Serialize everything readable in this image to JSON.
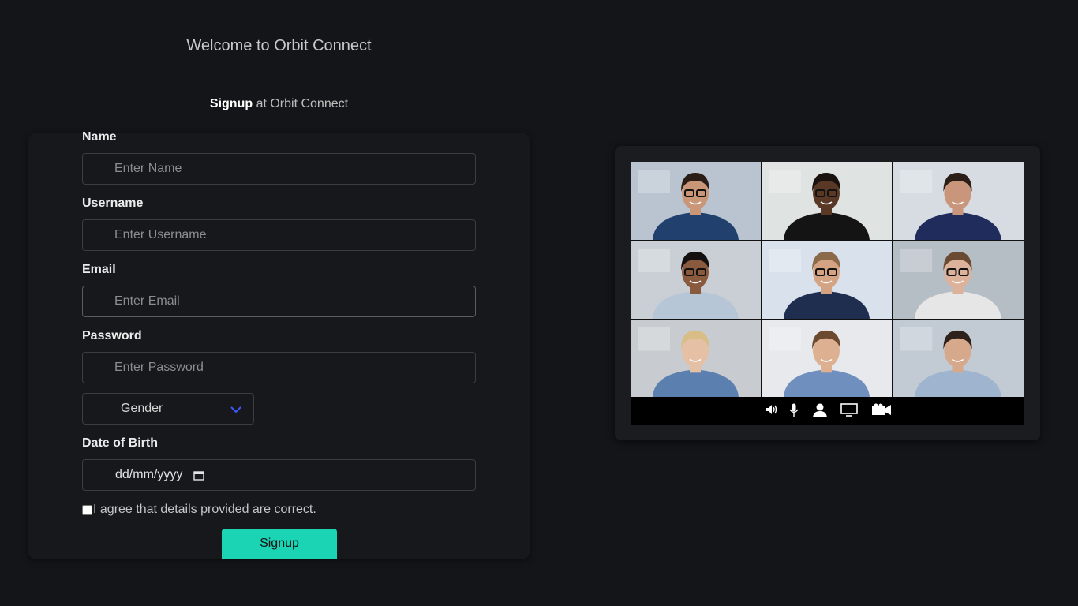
{
  "header": {
    "welcome": "Welcome to Orbit Connect",
    "signup_bold": "Signup",
    "signup_rest": " at Orbit Connect"
  },
  "form": {
    "name": {
      "label": "Name",
      "placeholder": "Enter Name"
    },
    "username": {
      "label": "Username",
      "placeholder": "Enter Username"
    },
    "email": {
      "label": "Email",
      "placeholder": "Enter Email"
    },
    "password": {
      "label": "Password",
      "placeholder": "Enter Password"
    },
    "gender": {
      "selected": "Gender"
    },
    "dob": {
      "label": "Date of Birth",
      "value": "dd/mm/yyyy"
    },
    "agree": "I agree that details provided are correct.",
    "submit": "Signup"
  },
  "preview": {
    "participants": [
      {
        "bg": "#b9c4d0",
        "skin": "#c99678",
        "hair": "#2a1d16",
        "shirt": "#22406e",
        "glasses": true
      },
      {
        "bg": "#dfe3e2",
        "skin": "#5a3826",
        "hair": "#1a120e",
        "shirt": "#141414",
        "glasses": true
      },
      {
        "bg": "#d6dce2",
        "skin": "#c9967c",
        "hair": "#2b1e17",
        "shirt": "#1f2c5c",
        "glasses": false
      },
      {
        "bg": "#c9cfd4",
        "skin": "#8a5a3e",
        "hair": "#151010",
        "shirt": "#b7c6d6",
        "glasses": true
      },
      {
        "bg": "#d9e2ec",
        "skin": "#d4a384",
        "hair": "#8a6a48",
        "shirt": "#1f2d4f",
        "glasses": true
      },
      {
        "bg": "#b5bdc5",
        "skin": "#dcb29a",
        "hair": "#6a4a30",
        "shirt": "#e6e6e6",
        "glasses": true
      },
      {
        "bg": "#c8ccd0",
        "skin": "#e6c0a4",
        "hair": "#d8bd86",
        "shirt": "#5b7fae",
        "glasses": false
      },
      {
        "bg": "#e7e9ec",
        "skin": "#ddb092",
        "hair": "#6b4a30",
        "shirt": "#6f8fbf",
        "glasses": false
      },
      {
        "bg": "#c2cad3",
        "skin": "#d6a98c",
        "hair": "#2e2119",
        "shirt": "#9fb5cf",
        "glasses": false
      }
    ],
    "toolbar_icons": [
      "speaker-icon",
      "microphone-icon",
      "person-icon",
      "screen-share-icon",
      "video-camera-icon"
    ]
  },
  "colors": {
    "accent": "#1ad4b3",
    "background": "#141518",
    "card": "#17181c",
    "chevron": "#3d5afe"
  }
}
